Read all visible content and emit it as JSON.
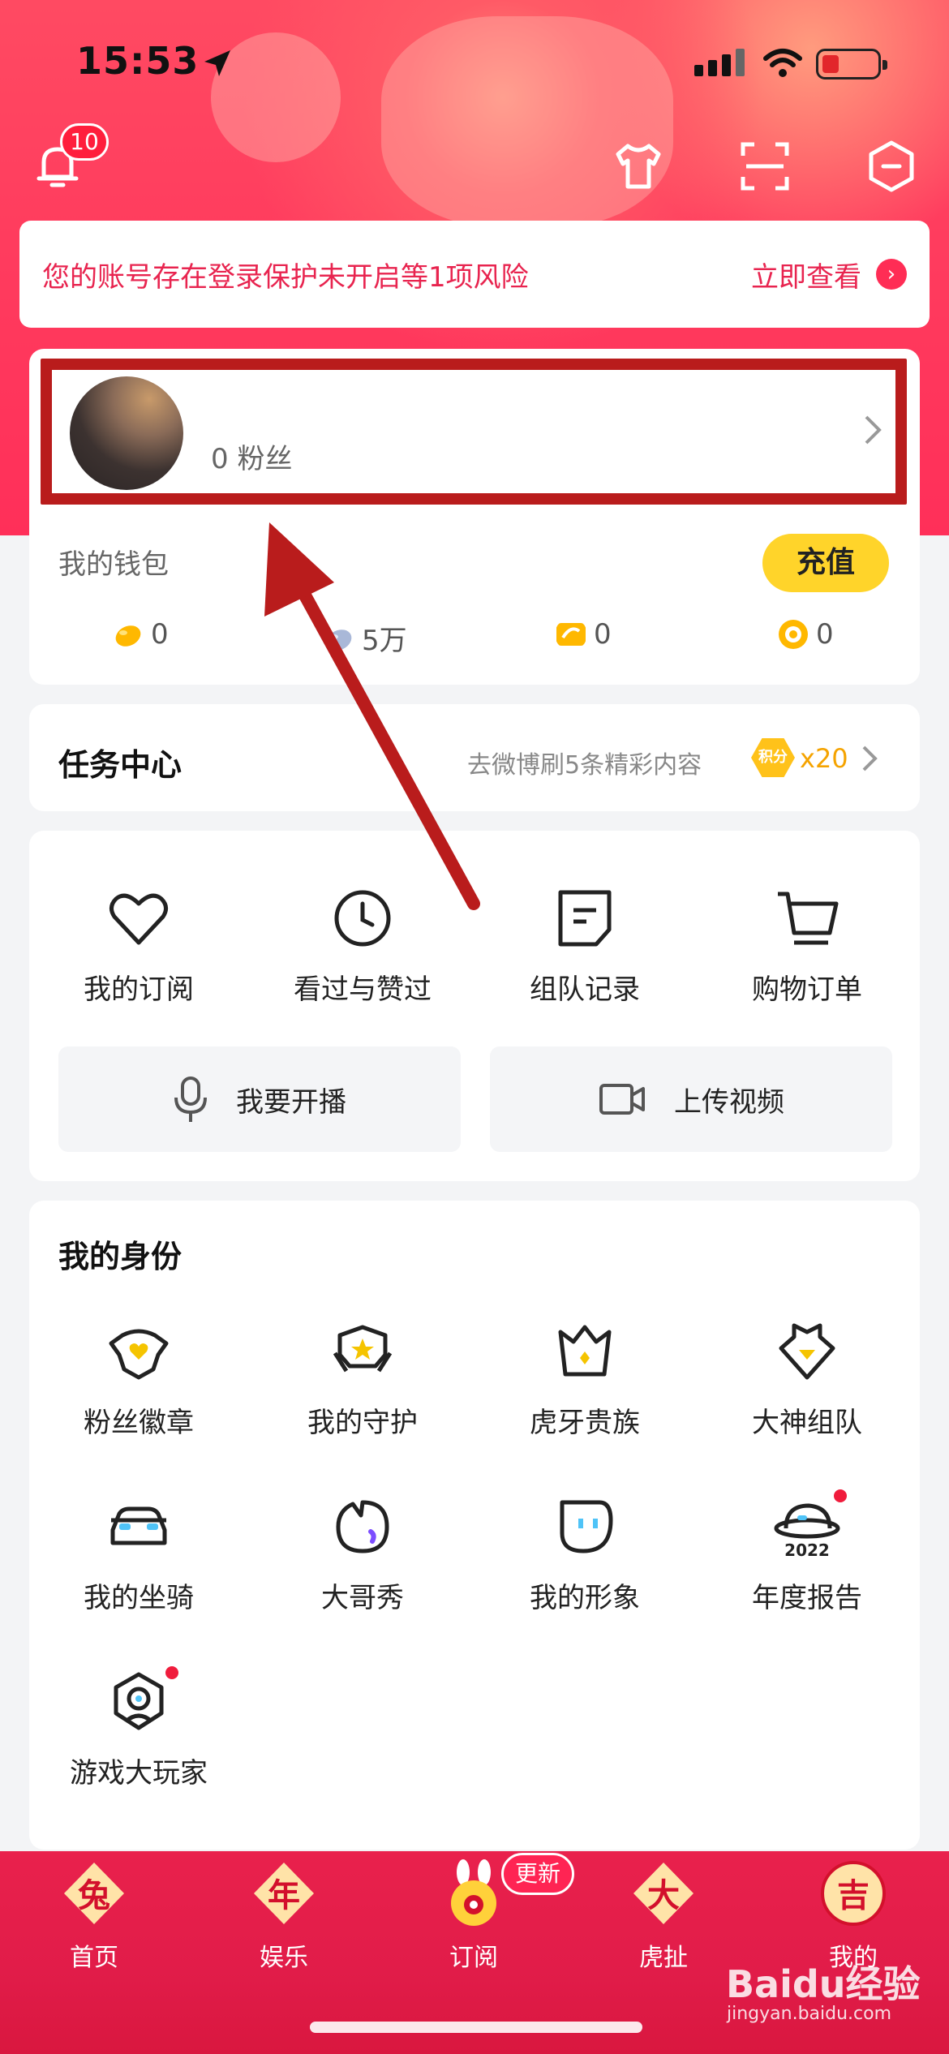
{
  "status_bar": {
    "time": "15:53"
  },
  "top_bar": {
    "notification_count": "10",
    "icons": [
      "bell-icon",
      "tshirt-icon",
      "scan-icon",
      "shield-minus-icon"
    ]
  },
  "risk_banner": {
    "text": "您的账号存在登录保护未开启等1项风险",
    "action": "立即查看",
    "action_icon": "chevron-right-icon"
  },
  "profile": {
    "fans": "0 粉丝"
  },
  "wallet": {
    "title": "我的钱包",
    "charge_label": "充值",
    "items": [
      {
        "icon": "gold-bean-icon",
        "value": "0"
      },
      {
        "icon": "silver-bean-icon",
        "value": "5万"
      },
      {
        "icon": "ticket-icon",
        "value": "0"
      },
      {
        "icon": "coin-icon",
        "value": "0"
      }
    ]
  },
  "task_center": {
    "title": "任务中心",
    "desc": "去微博刷5条精彩内容",
    "badge": "积分",
    "reward": "x20"
  },
  "shortcuts": {
    "items": [
      {
        "icon": "heart-icon",
        "label": "我的订阅"
      },
      {
        "icon": "clock-icon",
        "label": "看过与赞过"
      },
      {
        "icon": "note-icon",
        "label": "组队记录"
      },
      {
        "icon": "cart-icon",
        "label": "购物订单"
      }
    ],
    "buttons": [
      {
        "icon": "microphone-icon",
        "label": "我要开播"
      },
      {
        "icon": "video-camera-icon",
        "label": "上传视频"
      }
    ]
  },
  "identity": {
    "title": "我的身份",
    "items": [
      {
        "icon": "fan-badge-icon",
        "label": "粉丝徽章"
      },
      {
        "icon": "guard-icon",
        "label": "我的守护"
      },
      {
        "icon": "crown-icon",
        "label": "虎牙贵族"
      },
      {
        "icon": "diamond-icon",
        "label": "大神组队"
      },
      {
        "icon": "car-icon",
        "label": "我的坐骑"
      },
      {
        "icon": "bubble-icon",
        "label": "大哥秀"
      },
      {
        "icon": "avatar-face-icon",
        "label": "我的形象"
      },
      {
        "icon": "planet-2022-icon",
        "label": "年度报告",
        "extra": "2022"
      },
      {
        "icon": "magnifier-player-icon",
        "label": "游戏大玩家"
      }
    ]
  },
  "bottom_nav": {
    "items": [
      {
        "icon": "rabbit-char-icon",
        "glyph": "兔",
        "label": "首页"
      },
      {
        "icon": "year-char-icon",
        "glyph": "年",
        "label": "娱乐"
      },
      {
        "icon": "rabbit-mascot-icon",
        "glyph": "",
        "label": "订阅"
      },
      {
        "icon": "big-char-icon",
        "glyph": "大",
        "label": "虎扯"
      },
      {
        "icon": "lucky-char-icon",
        "glyph": "吉",
        "label": "我的"
      }
    ],
    "update_badge": "更新"
  },
  "watermark": {
    "brand": "Baidu经验",
    "url": "jingyan.baidu.com"
  },
  "colors": {
    "accent": "#e8244f",
    "nav_bg": "#e1214a",
    "charge": "#ffd42a",
    "highlight_box": "#b91c1c",
    "arrow": "#b91c1c"
  }
}
